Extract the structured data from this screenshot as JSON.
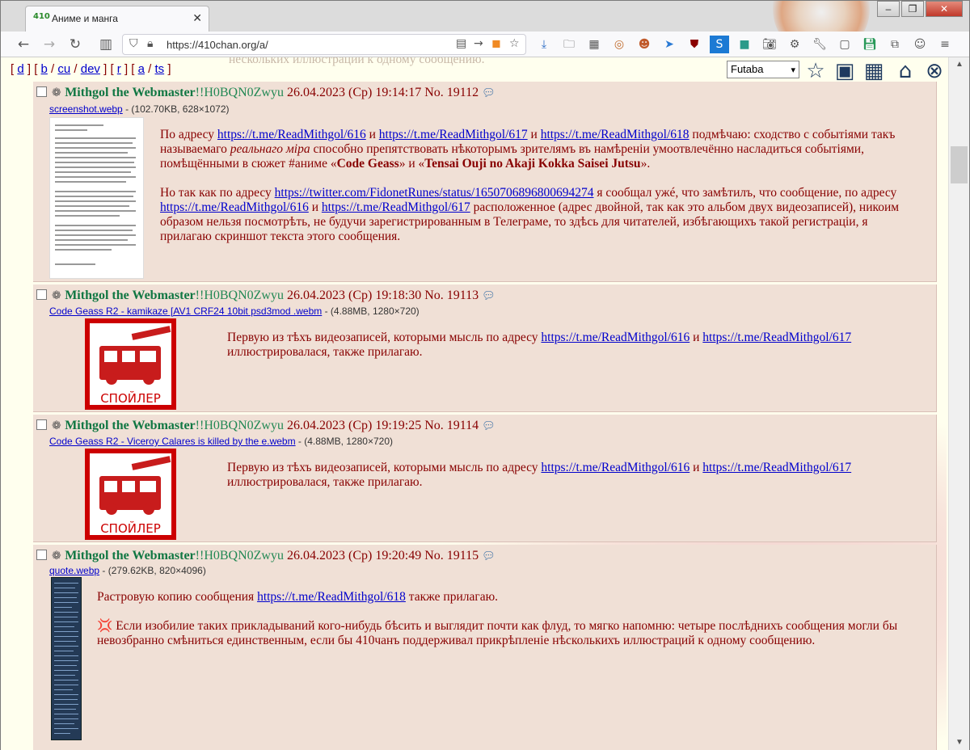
{
  "window": {
    "tab_title": "Аниме и манга",
    "controls": [
      "–",
      "❐",
      "✕"
    ]
  },
  "navbar": {
    "url": "https://410chan.org/a/"
  },
  "board_nav": {
    "prefix": "[ ",
    "links": [
      "d",
      "b",
      "cu",
      "dev",
      "r",
      "a",
      "ts"
    ],
    "style_select": "Futaba"
  },
  "ghost_text": "нескольких иллюстраций к одному сообщению.",
  "posts": [
    {
      "name": "Mithgol the Webmaster",
      "trip": "!!H0BQN0Zwyu",
      "date": "26.04.2023 (Ср) 19:14:17",
      "num": "No. 19112",
      "file_link": "screenshot.webp",
      "file_meta": " - (102.70KB, 628×1072)",
      "p1_a": "По адресу ",
      "p1_l1": "https://t.me/ReadMithgol/616",
      "p1_b": " и ",
      "p1_l2": "https://t.me/ReadMithgol/617",
      "p1_c": " и ",
      "p1_l3": "https://t.me/ReadMithgol/618",
      "p1_d": " подмѣчаю: сходство с событіями такъ называемаго ",
      "p1_em": "реальнаго міра",
      "p1_e": " способно препятствовать нѣкоторымъ зрителямъ въ намѣреніи умоотвлечённо насладиться событіями, помѣщёнными в сюжет #аниме «",
      "p1_b1": "Code Geass",
      "p1_f": "» и «",
      "p1_b2": "Tensai Ouji no Akaji Kokka Saisei Jutsu",
      "p1_g": "».",
      "p2_a": "Но так как по адресу ",
      "p2_l1": "https://twitter.com/FidonetRunes/status/1650706896800694274",
      "p2_b": " я сообщал ужé, что замѣтилъ, что сообщение, по адресу ",
      "p2_l2": "https://t.me/ReadMithgol/616",
      "p2_c": " и ",
      "p2_l3": "https://t.me/ReadMithgol/617",
      "p2_d": " расположенное (адрес двойной, так как это альбом двух видеозаписей), никоим образом нельзя посмотрѣть, не будучи зарегистрированным в Телеграме, то здѣсь для читателей, избѣгающихъ такой регистраціи, я прилагаю скриншот текста этого сообщения."
    },
    {
      "name": "Mithgol the Webmaster",
      "trip": "!!H0BQN0Zwyu",
      "date": "26.04.2023 (Ср) 19:18:30",
      "num": "No. 19113",
      "file_link": "Code Geass R2 - kamikaze [AV1 CRF24 10bit psd3mod .webm",
      "file_meta": " - (4.88MB, 1280×720)",
      "spoiler": "СПОЙЛЕР",
      "t_a": "Первую из тѣхъ видеозаписей, которыми мысль по адресу ",
      "t_l1": "https://t.me/ReadMithgol/616",
      "t_b": " и ",
      "t_l2": "https://t.me/ReadMithgol/617",
      "t_c": " иллюстрировалася, также прилагаю."
    },
    {
      "name": "Mithgol the Webmaster",
      "trip": "!!H0BQN0Zwyu",
      "date": "26.04.2023 (Ср) 19:19:25",
      "num": "No. 19114",
      "file_link": "Code Geass R2 - Viceroy Calares is killed by the e.webm",
      "file_meta": " - (4.88MB, 1280×720)",
      "spoiler": "СПОЙЛЕР",
      "t_a": "Первую из тѣхъ видеозаписей, которыми мысль по адресу ",
      "t_l1": "https://t.me/ReadMithgol/616",
      "t_b": " и ",
      "t_l2": "https://t.me/ReadMithgol/617",
      "t_c": " иллюстрировалася, также прилагаю."
    },
    {
      "name": "Mithgol the Webmaster",
      "trip": "!!H0BQN0Zwyu",
      "date": "26.04.2023 (Ср) 19:20:49",
      "num": "No. 19115",
      "file_link": "quote.webp",
      "file_meta": " - (279.62KB, 820×4096)",
      "q_a": "Растровую копию сообщения ",
      "q_l1": "https://t.me/ReadMithgol/618",
      "q_b": " также прилагаю.",
      "q_icon": "💢",
      "q_c": " Если изобилие таких прикладываний кого-нибудь бѣсить и выглядит почти как флуд, то мягко напомню: четыре послѣднихъ сообщения могли бы невозбранно смѣниться единственным, если бы 410чанъ поддерживал прикрѣпленіе нѣсколькихъ иллюстраций к одному сообщению."
    }
  ]
}
